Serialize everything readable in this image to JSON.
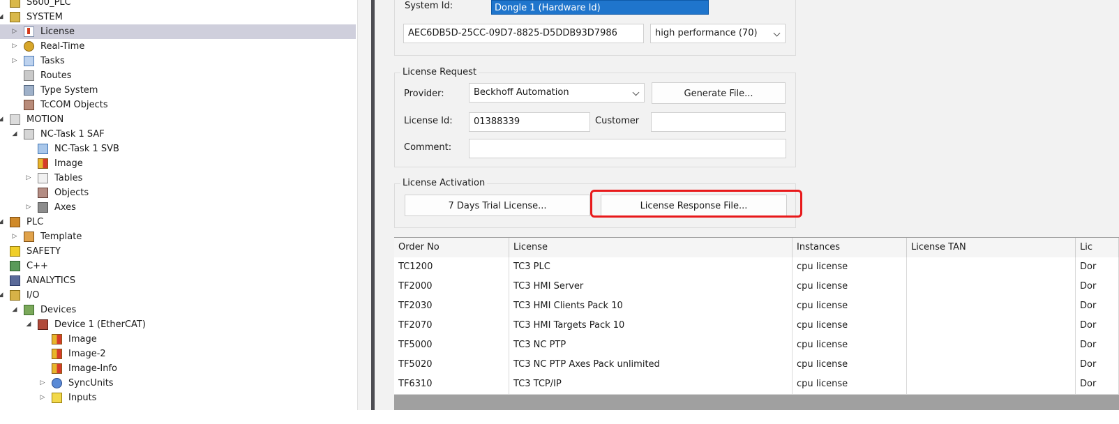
{
  "tree": {
    "nodes": [
      {
        "label": "S600_PLC",
        "icon": "project-icon",
        "cls": "i-sys",
        "arrow": "",
        "depth": 0,
        "selected": false
      },
      {
        "label": "SYSTEM",
        "icon": "system-icon",
        "cls": "i-sys",
        "arrow": "down",
        "depth": 0,
        "selected": false
      },
      {
        "label": "License",
        "icon": "license-icon",
        "cls": "i-lic",
        "arrow": "right",
        "depth": 1,
        "selected": true
      },
      {
        "label": "Real-Time",
        "icon": "realtime-icon",
        "cls": "i-rt",
        "arrow": "right",
        "depth": 1,
        "selected": false
      },
      {
        "label": "Tasks",
        "icon": "tasks-icon",
        "cls": "i-task",
        "arrow": "right",
        "depth": 1,
        "selected": false
      },
      {
        "label": "Routes",
        "icon": "routes-icon",
        "cls": "i-routes",
        "arrow": "",
        "depth": 1,
        "selected": false
      },
      {
        "label": "Type System",
        "icon": "type-system-icon",
        "cls": "i-type",
        "arrow": "",
        "depth": 1,
        "selected": false
      },
      {
        "label": "TcCOM Objects",
        "icon": "tccom-icon",
        "cls": "i-tcom",
        "arrow": "",
        "depth": 1,
        "selected": false
      },
      {
        "label": "MOTION",
        "icon": "motion-icon",
        "cls": "i-motion",
        "arrow": "down",
        "depth": 0,
        "selected": false
      },
      {
        "label": "NC-Task 1 SAF",
        "icon": "nc-task-icon",
        "cls": "i-nc",
        "arrow": "down",
        "depth": 1,
        "selected": false
      },
      {
        "label": "NC-Task 1 SVB",
        "icon": "nc-svb-icon",
        "cls": "i-ncs",
        "arrow": "",
        "depth": 2,
        "selected": false
      },
      {
        "label": "Image",
        "icon": "image-icon",
        "cls": "i-img",
        "arrow": "",
        "depth": 2,
        "selected": false
      },
      {
        "label": "Tables",
        "icon": "tables-icon",
        "cls": "i-table",
        "arrow": "right",
        "depth": 2,
        "selected": false
      },
      {
        "label": "Objects",
        "icon": "objects-icon",
        "cls": "i-obj",
        "arrow": "",
        "depth": 2,
        "selected": false
      },
      {
        "label": "Axes",
        "icon": "axes-icon",
        "cls": "i-axes",
        "arrow": "right",
        "depth": 2,
        "selected": false
      },
      {
        "label": "PLC",
        "icon": "plc-icon",
        "cls": "i-plc",
        "arrow": "down",
        "depth": 0,
        "selected": false
      },
      {
        "label": "Template",
        "icon": "template-icon",
        "cls": "i-tpl",
        "arrow": "right",
        "depth": 1,
        "selected": false
      },
      {
        "label": "SAFETY",
        "icon": "safety-icon",
        "cls": "i-safety",
        "arrow": "",
        "depth": 0,
        "selected": false
      },
      {
        "label": "C++",
        "icon": "cpp-icon",
        "cls": "i-cpp",
        "arrow": "",
        "depth": 0,
        "selected": false
      },
      {
        "label": "ANALYTICS",
        "icon": "analytics-icon",
        "cls": "i-ana",
        "arrow": "",
        "depth": 0,
        "selected": false
      },
      {
        "label": "I/O",
        "icon": "io-icon",
        "cls": "i-io",
        "arrow": "down",
        "depth": 0,
        "selected": false
      },
      {
        "label": "Devices",
        "icon": "devices-icon",
        "cls": "i-dev",
        "arrow": "down",
        "depth": 1,
        "selected": false
      },
      {
        "label": "Device 1 (EtherCAT)",
        "icon": "ethercat-device-icon",
        "cls": "i-ecat",
        "arrow": "down",
        "depth": 2,
        "selected": false
      },
      {
        "label": "Image",
        "icon": "image-icon",
        "cls": "i-img",
        "arrow": "",
        "depth": 3,
        "selected": false
      },
      {
        "label": "Image-2",
        "icon": "image-icon",
        "cls": "i-img",
        "arrow": "",
        "depth": 3,
        "selected": false
      },
      {
        "label": "Image-Info",
        "icon": "image-icon",
        "cls": "i-img",
        "arrow": "",
        "depth": 3,
        "selected": false
      },
      {
        "label": "SyncUnits",
        "icon": "syncunits-icon",
        "cls": "i-sync",
        "arrow": "right",
        "depth": 3,
        "selected": false
      },
      {
        "label": "Inputs",
        "icon": "inputs-icon",
        "cls": "i-inp",
        "arrow": "right",
        "depth": 3,
        "selected": false
      }
    ]
  },
  "system": {
    "label": "System Id:",
    "dropdown_option": "Dongle 1 (Hardware Id)",
    "id_value": "AEC6DB5D-25CC-09D7-8825-D5DDB93D7986",
    "platform_value": "high performance (70)"
  },
  "request": {
    "title": "License Request",
    "provider_label": "Provider:",
    "provider_value": "Beckhoff Automation",
    "generate_button": "Generate File...",
    "license_id_label": "License Id:",
    "license_id_value": "01388339",
    "customer_label": "Customer",
    "customer_value": "",
    "comment_label": "Comment:",
    "comment_value": ""
  },
  "activation": {
    "title": "License Activation",
    "trial_button": "7 Days Trial License...",
    "response_button": "License Response File..."
  },
  "table": {
    "columns": [
      "Order No",
      "License",
      "Instances",
      "License TAN",
      "Lic"
    ],
    "rows": [
      [
        "TC1200",
        "TC3 PLC",
        "cpu license",
        "",
        "Dor"
      ],
      [
        "TF2000",
        "TC3 HMI Server",
        "cpu license",
        "",
        "Dor"
      ],
      [
        "TF2030",
        "TC3 HMI Clients Pack 10",
        "cpu license",
        "",
        "Dor"
      ],
      [
        "TF2070",
        "TC3 HMI Targets Pack 10",
        "cpu license",
        "",
        "Dor"
      ],
      [
        "TF5000",
        "TC3 NC PTP",
        "cpu license",
        "",
        "Dor"
      ],
      [
        "TF5020",
        "TC3 NC PTP Axes Pack unlimited",
        "cpu license",
        "",
        "Dor"
      ],
      [
        "TF6310",
        "TC3 TCP/IP",
        "cpu license",
        "",
        "Dor"
      ]
    ]
  },
  "colors": {
    "highlight": "#e8191b",
    "selection": "#1f75cc"
  }
}
